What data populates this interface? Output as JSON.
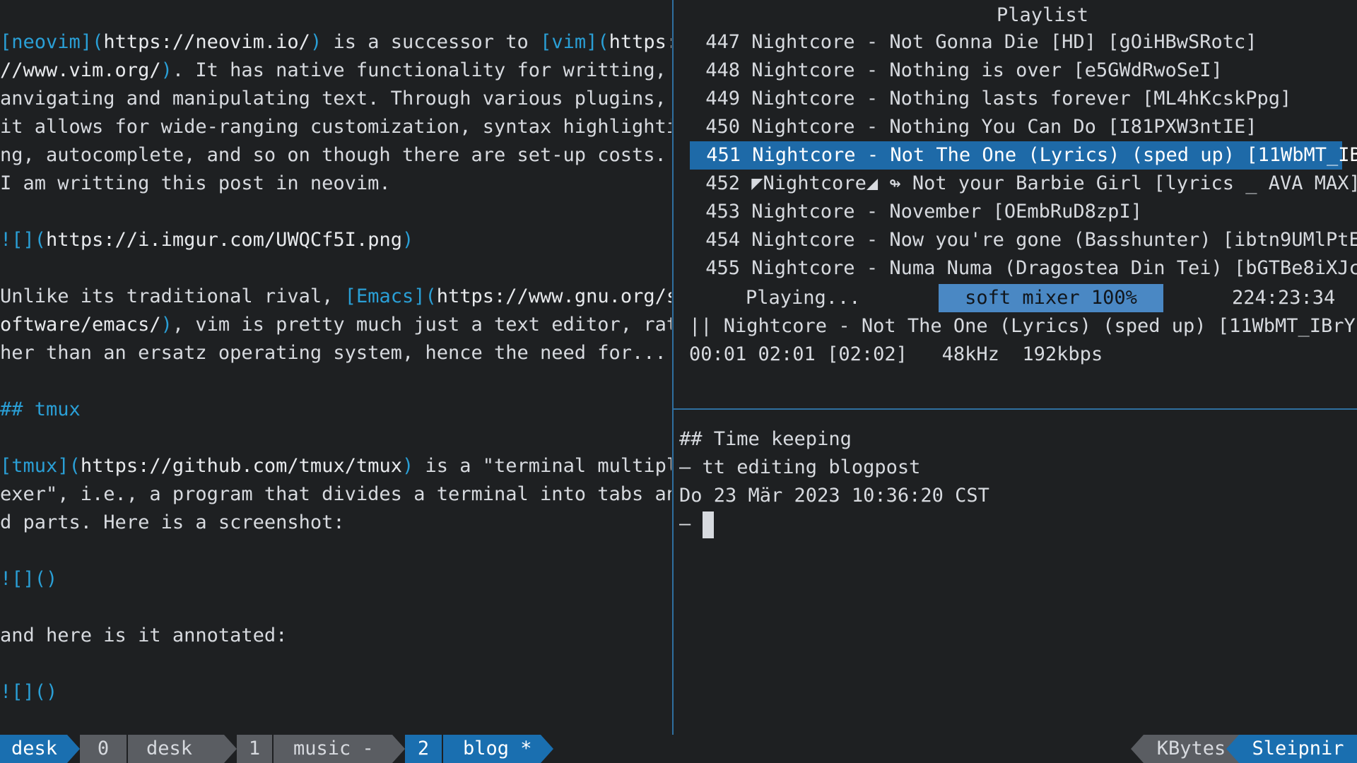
{
  "editor": {
    "lines": [
      {
        "parts": [
          [
            "[",
            "bl"
          ],
          [
            "neovim",
            "bl"
          ],
          [
            "]",
            "bl"
          ],
          [
            "(",
            "bl"
          ],
          [
            "https://neovim.io/",
            "lnk"
          ],
          [
            ")",
            "bl"
          ],
          [
            " is a successor to ",
            ""
          ],
          [
            "[",
            "bl"
          ],
          [
            "vim",
            "bl"
          ],
          [
            "]",
            "bl"
          ],
          [
            "(",
            "bl"
          ],
          [
            "https:",
            "lnk"
          ]
        ]
      },
      {
        "parts": [
          [
            "//www.vim.org/",
            "lnk"
          ],
          [
            ")",
            "bl"
          ],
          [
            ". It has native functionality for writting,",
            ""
          ]
        ]
      },
      {
        "parts": [
          [
            "anvigating and manipulating text. Through various plugins,",
            ""
          ]
        ]
      },
      {
        "parts": [
          [
            "it allows for wide-ranging customization, syntax highlighti",
            ""
          ]
        ]
      },
      {
        "parts": [
          [
            "ng, autocomplete, and so on though there are set-up costs.",
            ""
          ]
        ]
      },
      {
        "parts": [
          [
            "I am writting this post in neovim.",
            ""
          ]
        ]
      },
      {
        "parts": []
      },
      {
        "parts": [
          [
            "![]",
            "bl"
          ],
          [
            "(",
            "bl"
          ],
          [
            "https://i.imgur.com/UWQCf5I.png",
            "lnk"
          ],
          [
            ")",
            "bl"
          ]
        ]
      },
      {
        "parts": []
      },
      {
        "parts": [
          [
            "Unlike its traditional rival, ",
            ""
          ],
          [
            "[",
            "bl"
          ],
          [
            "Emacs",
            "bl"
          ],
          [
            "]",
            "bl"
          ],
          [
            "(",
            "bl"
          ],
          [
            "https://www.gnu.org/s",
            "lnk"
          ]
        ]
      },
      {
        "parts": [
          [
            "oftware/emacs/",
            "lnk"
          ],
          [
            ")",
            "bl"
          ],
          [
            ", vim is pretty much just a text editor, rat",
            ""
          ]
        ]
      },
      {
        "parts": [
          [
            "her than an ersatz operating system, hence the need for...",
            ""
          ]
        ]
      },
      {
        "parts": []
      },
      {
        "parts": [
          [
            "## ",
            "bl"
          ],
          [
            "tmux",
            "bl"
          ]
        ]
      },
      {
        "parts": []
      },
      {
        "parts": [
          [
            "[",
            "bl"
          ],
          [
            "tmux",
            "bl"
          ],
          [
            "]",
            "bl"
          ],
          [
            "(",
            "bl"
          ],
          [
            "https://github.com/tmux/tmux",
            "lnk"
          ],
          [
            ")",
            "bl"
          ],
          [
            " is a \"terminal multipl",
            ""
          ]
        ]
      },
      {
        "parts": [
          [
            "exer\", i.e., a program that divides a terminal into tabs an",
            ""
          ]
        ]
      },
      {
        "parts": [
          [
            "d parts. Here is a screenshot:",
            ""
          ]
        ]
      },
      {
        "parts": []
      },
      {
        "parts": [
          [
            "![]()",
            "bl"
          ]
        ]
      },
      {
        "parts": []
      },
      {
        "parts": [
          [
            "and here is it annotated:",
            ""
          ]
        ]
      },
      {
        "parts": []
      },
      {
        "parts": [
          [
            "![]()",
            "bl"
          ]
        ]
      }
    ]
  },
  "player": {
    "title": "Playlist",
    "tracks": [
      {
        "num": "447",
        "text": "Nightcore - Not Gonna Die [HD] [gOiHBwSRotc]"
      },
      {
        "num": "448",
        "text": "Nightcore - Nothing is over [e5GWdRwoSeI]"
      },
      {
        "num": "449",
        "text": "Nightcore - Nothing lasts forever [ML4hKcskPpg]"
      },
      {
        "num": "450",
        "text": "Nightcore - Nothing You Can Do [I81PXW3ntIE]"
      },
      {
        "num": "451",
        "text": "Nightcore - Not The One (Lyrics) (sped up) [11WbMT_IB",
        "selected": true
      },
      {
        "num": "452",
        "text": "◤Nightcore◢ ↬ Not your Barbie Girl [lyrics _ AVA MAX]"
      },
      {
        "num": "453",
        "text": "Nightcore - November [OEmbRuD8zpI]"
      },
      {
        "num": "454",
        "text": "Nightcore - Now you're gone (Basshunter) [ibtn9UMlPtE"
      },
      {
        "num": "455",
        "text": "Nightcore - Numa Numa (Dragostea Din Tei) [bGTBe8iXJc"
      }
    ],
    "status": "Playing...",
    "mixer": "soft mixer 100%",
    "counter": "224:23:34",
    "now_playing": "|| Nightcore - Not The One (Lyrics) (sped up) [11WbMT_IBrY",
    "time_info": "00:01 02:01 [02:02]   48kHz  192kbps"
  },
  "notes": {
    "lines": [
      "## Time keeping",
      "— tt editing blogpost",
      "Do 23 Mär 2023 10:36:20 CST",
      "— "
    ]
  },
  "statusbar": {
    "session": "desk",
    "win0_index": "0",
    "win0_name": "desk",
    "win1_index": "1",
    "win1_name": "music -",
    "win2_index": "2",
    "win2_name": "blog *",
    "right1": "KBytes",
    "right2": "Sleipnir"
  },
  "colors": {
    "background": "#1e2022",
    "accent": "#1a6fb0",
    "selection": "#1e6aa8",
    "link_syntax": "#2a9fd6",
    "mixer_bg": "#4a88c4",
    "segment_gray": "#5a5d62"
  }
}
